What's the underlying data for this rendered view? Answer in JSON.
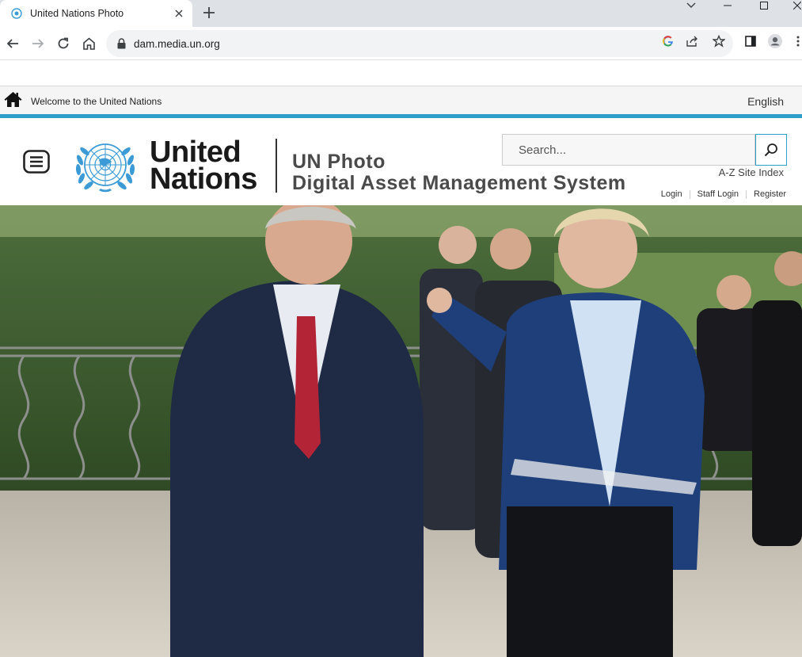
{
  "browser": {
    "tab_title": "United Nations Photo",
    "tab_close_icon": "close-icon",
    "new_tab_icon": "plus-icon",
    "url": "dam.media.un.org"
  },
  "topstrip": {
    "home_icon": "home-icon",
    "welcome": "Welcome to the United Nations",
    "language": "English"
  },
  "header": {
    "logo_line1": "United",
    "logo_line2": "Nations",
    "title_line1": "UN Photo",
    "title_line2": "Digital Asset Management System",
    "search_placeholder": "Search...",
    "az_index": "A-Z Site Index",
    "links": {
      "login": "Login",
      "staff_login": "Staff Login",
      "register": "Register"
    }
  },
  "colors": {
    "accent": "#2d9fc9",
    "un_blue": "#3c9bd6"
  }
}
